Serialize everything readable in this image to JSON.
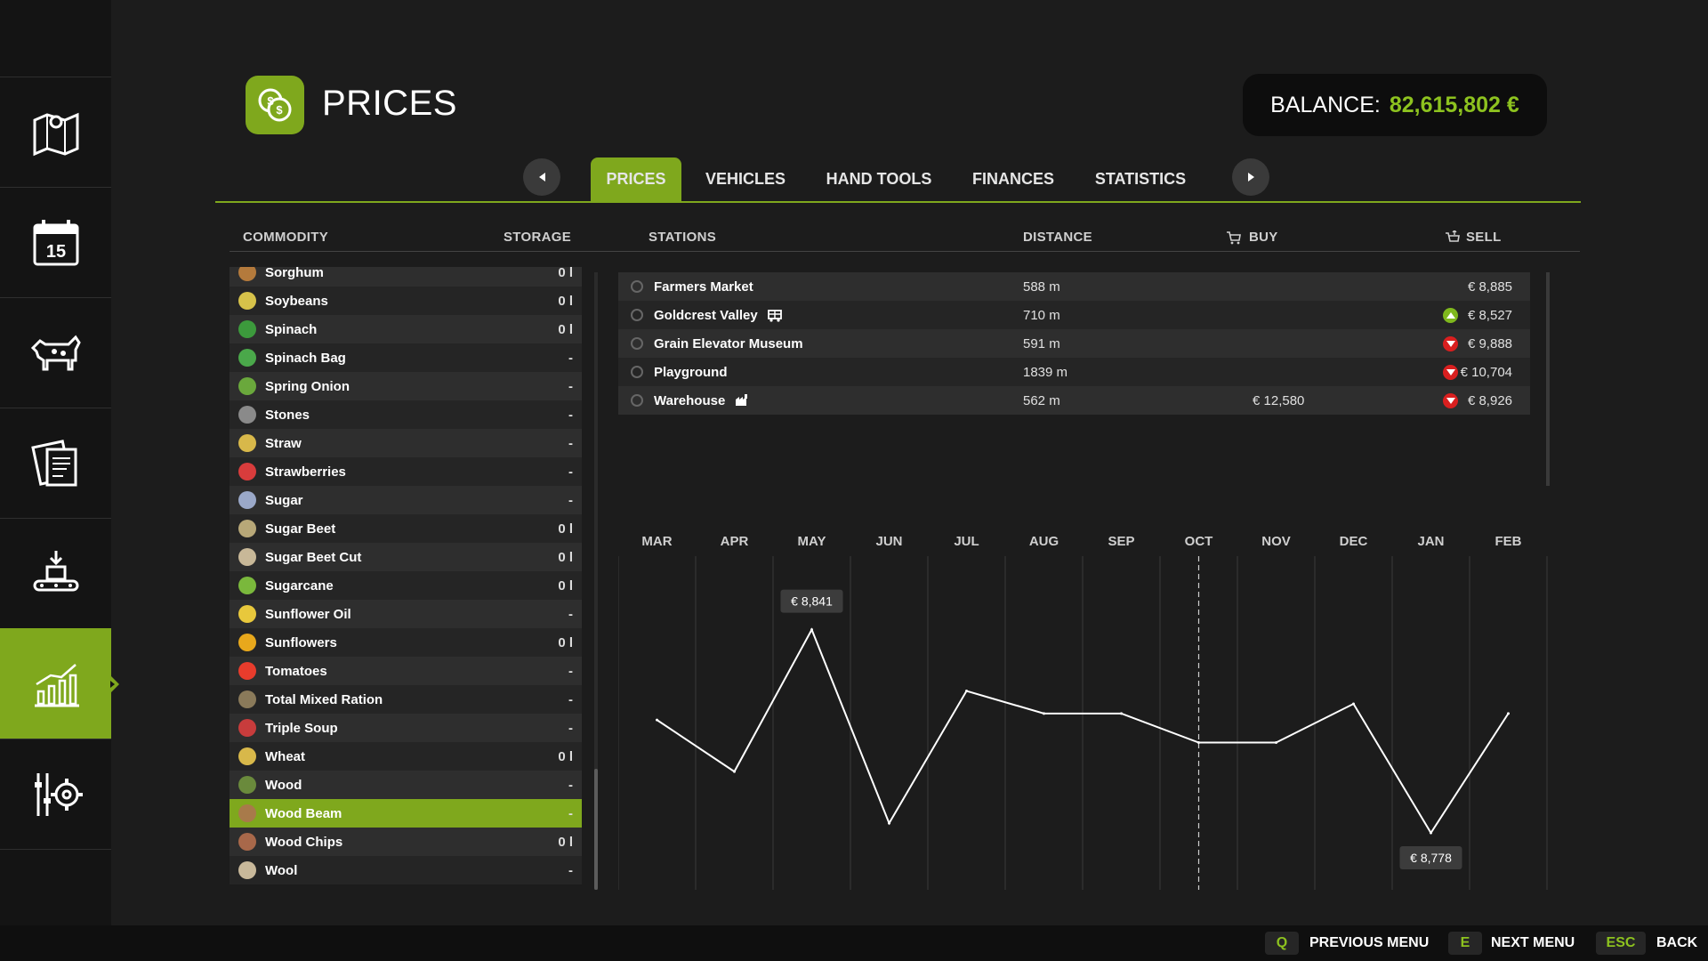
{
  "header": {
    "title": "PRICES",
    "balance_label": "BALANCE:",
    "balance_value": "82,615,802 €"
  },
  "sidebar": {
    "items": [
      {
        "name": "map-icon",
        "active": false
      },
      {
        "name": "calendar-icon",
        "label": "15",
        "active": false
      },
      {
        "name": "cow-icon",
        "active": false
      },
      {
        "name": "contracts-icon",
        "active": false
      },
      {
        "name": "production-icon",
        "active": false
      },
      {
        "name": "prices-chart-icon",
        "active": true
      },
      {
        "name": "settings-icon",
        "active": false
      }
    ]
  },
  "tabs": [
    {
      "label": "PRICES",
      "active": true
    },
    {
      "label": "VEHICLES",
      "active": false
    },
    {
      "label": "HAND TOOLS",
      "active": false
    },
    {
      "label": "FINANCES",
      "active": false
    },
    {
      "label": "STATISTICS",
      "active": false
    }
  ],
  "columns": {
    "commodity": "COMMODITY",
    "storage": "STORAGE",
    "stations": "STATIONS",
    "distance": "DISTANCE",
    "buy": "BUY",
    "sell": "SELL"
  },
  "commodities": [
    {
      "name": "Sorghum",
      "storage": "0 l",
      "icon_color": "#b47a3c"
    },
    {
      "name": "Soybeans",
      "storage": "0 l",
      "icon_color": "#d6c24a"
    },
    {
      "name": "Spinach",
      "storage": "0 l",
      "icon_color": "#3c9a3c"
    },
    {
      "name": "Spinach Bag",
      "storage": "-",
      "icon_color": "#4aa84a"
    },
    {
      "name": "Spring Onion",
      "storage": "-",
      "icon_color": "#6aa83c"
    },
    {
      "name": "Stones",
      "storage": "-",
      "icon_color": "#8a8a8a"
    },
    {
      "name": "Straw",
      "storage": "-",
      "icon_color": "#d8b84a"
    },
    {
      "name": "Strawberries",
      "storage": "-",
      "icon_color": "#d83c3c"
    },
    {
      "name": "Sugar",
      "storage": "-",
      "icon_color": "#9aa8c8"
    },
    {
      "name": "Sugar Beet",
      "storage": "0 l",
      "icon_color": "#b8a878"
    },
    {
      "name": "Sugar Beet Cut",
      "storage": "0 l",
      "icon_color": "#c8b898"
    },
    {
      "name": "Sugarcane",
      "storage": "0 l",
      "icon_color": "#7ab83c"
    },
    {
      "name": "Sunflower Oil",
      "storage": "-",
      "icon_color": "#e8c83c"
    },
    {
      "name": "Sunflowers",
      "storage": "0 l",
      "icon_color": "#e8a81c"
    },
    {
      "name": "Tomatoes",
      "storage": "-",
      "icon_color": "#e83c2c"
    },
    {
      "name": "Total Mixed Ration",
      "storage": "-",
      "icon_color": "#8a7a5a"
    },
    {
      "name": "Triple Soup",
      "storage": "-",
      "icon_color": "#c83c3c"
    },
    {
      "name": "Wheat",
      "storage": "0 l",
      "icon_color": "#d8b84a"
    },
    {
      "name": "Wood",
      "storage": "-",
      "icon_color": "#6a8a3c"
    },
    {
      "name": "Wood Beam",
      "storage": "-",
      "icon_color": "#a87a4a",
      "selected": true
    },
    {
      "name": "Wood Chips",
      "storage": "0 l",
      "icon_color": "#a8684a"
    },
    {
      "name": "Wool",
      "storage": "-",
      "icon_color": "#c8b89a"
    }
  ],
  "stations": [
    {
      "name": "Farmers Market",
      "badge": "",
      "distance": "588 m",
      "buy": "",
      "trend": "",
      "sell": "€ 8,885"
    },
    {
      "name": "Goldcrest Valley",
      "badge": "train-icon",
      "distance": "710 m",
      "buy": "",
      "trend": "up",
      "sell": "€ 8,527"
    },
    {
      "name": "Grain Elevator Museum",
      "badge": "",
      "distance": "591 m",
      "buy": "",
      "trend": "down",
      "sell": "€ 9,888"
    },
    {
      "name": "Playground",
      "badge": "",
      "distance": "1839 m",
      "buy": "",
      "trend": "down",
      "sell": "€ 10,704"
    },
    {
      "name": "Warehouse",
      "badge": "factory-icon",
      "distance": "562 m",
      "buy": "€ 12,580",
      "trend": "down",
      "sell": "€ 8,926"
    }
  ],
  "chart_data": {
    "type": "line",
    "categories": [
      "MAR",
      "APR",
      "MAY",
      "JUN",
      "JUL",
      "AUG",
      "SEP",
      "OCT",
      "NOV",
      "DEC",
      "JAN",
      "FEB"
    ],
    "values": [
      8813,
      8797,
      8841,
      8781,
      8822,
      8815,
      8815,
      8806,
      8806,
      8818,
      8778,
      8815
    ],
    "current_month": "OCT",
    "annotations": [
      {
        "month": "MAY",
        "label": "€ 8,841"
      },
      {
        "month": "JAN",
        "label": "€ 8,778"
      }
    ],
    "ylim": [
      8770,
      8850
    ],
    "grid": true
  },
  "footer": {
    "actions": [
      {
        "key": "Q",
        "label": "PREVIOUS MENU"
      },
      {
        "key": "E",
        "label": "NEXT MENU"
      },
      {
        "key": "ESC",
        "label": "BACK"
      }
    ]
  }
}
